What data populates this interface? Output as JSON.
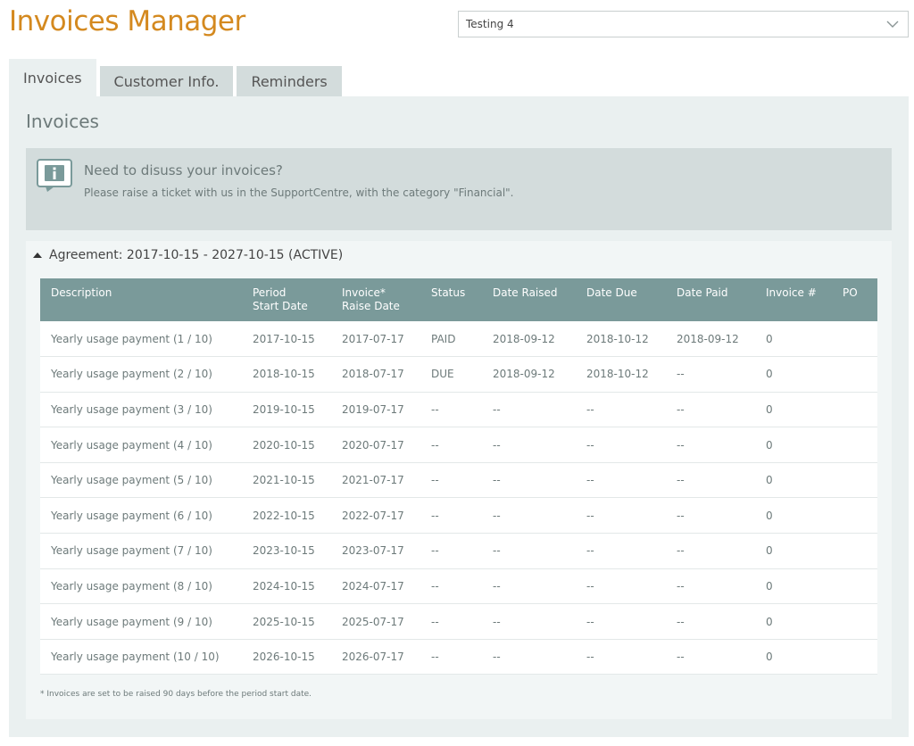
{
  "app": {
    "title": "Invoices Manager"
  },
  "account_select": {
    "value": "Testing 4"
  },
  "tabs": [
    {
      "label": "Invoices",
      "active": true
    },
    {
      "label": "Customer Info.",
      "active": false
    },
    {
      "label": "Reminders",
      "active": false
    }
  ],
  "panel": {
    "title": "Invoices"
  },
  "notice": {
    "icon": "info-icon",
    "title": "Need to disuss your invoices?",
    "body": "Please raise a ticket with us in the SupportCentre, with the category \"Financial\"."
  },
  "agreement": {
    "label": "Agreement: 2017-10-15 - 2027-10-15 (ACTIVE)",
    "expanded": true,
    "columns": [
      {
        "line1": "Description",
        "line2": ""
      },
      {
        "line1": "Period",
        "line2": "Start Date"
      },
      {
        "line1": "Invoice*",
        "line2": "Raise Date"
      },
      {
        "line1": "Status",
        "line2": ""
      },
      {
        "line1": "Date Raised",
        "line2": ""
      },
      {
        "line1": "Date Due",
        "line2": ""
      },
      {
        "line1": "Date Paid",
        "line2": ""
      },
      {
        "line1": "Invoice #",
        "line2": ""
      },
      {
        "line1": "PO",
        "line2": ""
      }
    ],
    "rows": [
      {
        "description": "Yearly usage payment (1 / 10)",
        "period_start": "2017-10-15",
        "raise_date": "2017-07-17",
        "status": "PAID",
        "date_raised": "2018-09-12",
        "date_due": "2018-10-12",
        "date_paid": "2018-09-12",
        "invoice_no": "0",
        "po": ""
      },
      {
        "description": "Yearly usage payment (2 / 10)",
        "period_start": "2018-10-15",
        "raise_date": "2018-07-17",
        "status": "DUE",
        "date_raised": "2018-09-12",
        "date_due": "2018-10-12",
        "date_paid": "--",
        "invoice_no": "0",
        "po": ""
      },
      {
        "description": "Yearly usage payment (3 / 10)",
        "period_start": "2019-10-15",
        "raise_date": "2019-07-17",
        "status": "--",
        "date_raised": "--",
        "date_due": "--",
        "date_paid": "--",
        "invoice_no": "0",
        "po": ""
      },
      {
        "description": "Yearly usage payment (4 / 10)",
        "period_start": "2020-10-15",
        "raise_date": "2020-07-17",
        "status": "--",
        "date_raised": "--",
        "date_due": "--",
        "date_paid": "--",
        "invoice_no": "0",
        "po": ""
      },
      {
        "description": "Yearly usage payment (5 / 10)",
        "period_start": "2021-10-15",
        "raise_date": "2021-07-17",
        "status": "--",
        "date_raised": "--",
        "date_due": "--",
        "date_paid": "--",
        "invoice_no": "0",
        "po": ""
      },
      {
        "description": "Yearly usage payment (6 / 10)",
        "period_start": "2022-10-15",
        "raise_date": "2022-07-17",
        "status": "--",
        "date_raised": "--",
        "date_due": "--",
        "date_paid": "--",
        "invoice_no": "0",
        "po": ""
      },
      {
        "description": "Yearly usage payment (7 / 10)",
        "period_start": "2023-10-15",
        "raise_date": "2023-07-17",
        "status": "--",
        "date_raised": "--",
        "date_due": "--",
        "date_paid": "--",
        "invoice_no": "0",
        "po": ""
      },
      {
        "description": "Yearly usage payment (8 / 10)",
        "period_start": "2024-10-15",
        "raise_date": "2024-07-17",
        "status": "--",
        "date_raised": "--",
        "date_due": "--",
        "date_paid": "--",
        "invoice_no": "0",
        "po": ""
      },
      {
        "description": "Yearly usage payment (9 / 10)",
        "period_start": "2025-10-15",
        "raise_date": "2025-07-17",
        "status": "--",
        "date_raised": "--",
        "date_due": "--",
        "date_paid": "--",
        "invoice_no": "0",
        "po": ""
      },
      {
        "description": "Yearly usage payment (10 / 10)",
        "period_start": "2026-10-15",
        "raise_date": "2026-07-17",
        "status": "--",
        "date_raised": "--",
        "date_due": "--",
        "date_paid": "--",
        "invoice_no": "0",
        "po": ""
      }
    ],
    "footnote": "* Invoices are set to be raised 90 days before the period start date."
  },
  "colors": {
    "brand": "#d4891f",
    "panel_bg": "#eaf0f0",
    "tab_inactive_bg": "#d3dcdc",
    "table_header_bg": "#7a9a9a"
  }
}
